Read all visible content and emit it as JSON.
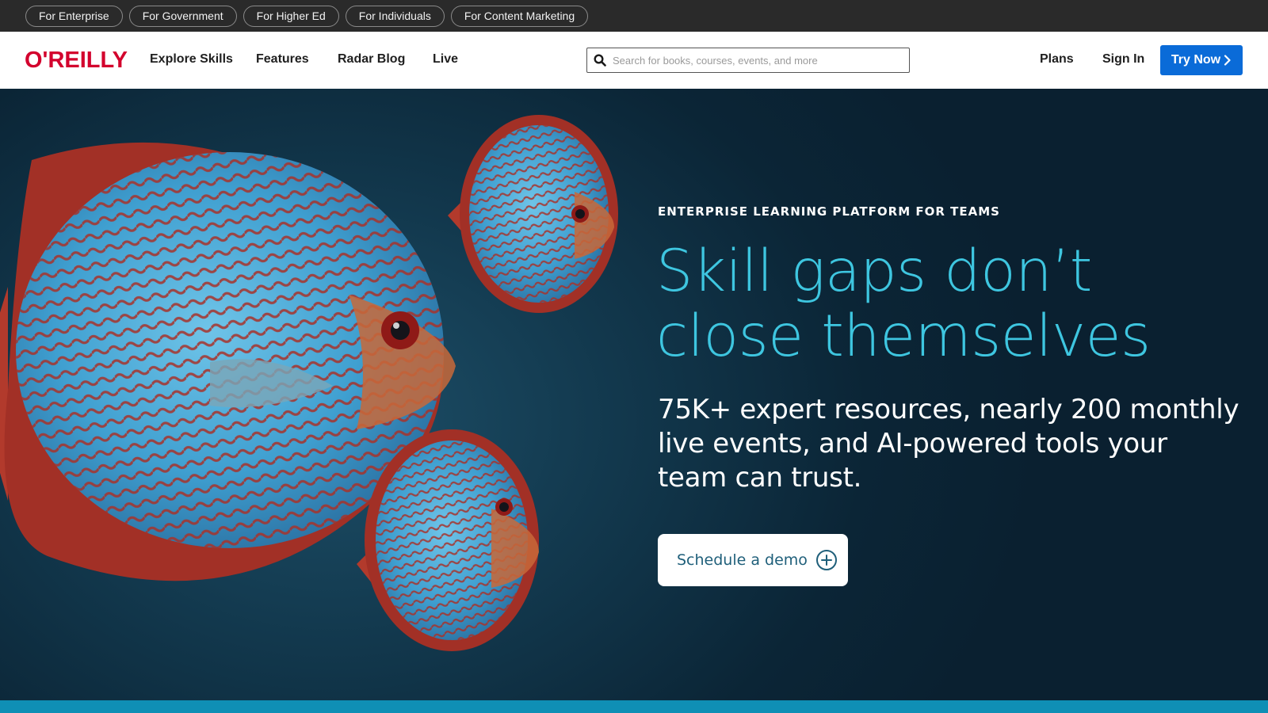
{
  "audience_bar": {
    "items": [
      "For Enterprise",
      "For Government",
      "For Higher Ed",
      "For Individuals",
      "For Content Marketing"
    ]
  },
  "nav": {
    "logo": "O'REILLY",
    "links": [
      "Explore Skills",
      "Features",
      "Radar Blog",
      "Live"
    ],
    "search_placeholder": "Search for books, courses, events, and more",
    "plans": "Plans",
    "sign_in": "Sign In",
    "try_now": "Try Now"
  },
  "hero": {
    "eyebrow": "ENTERPRISE LEARNING PLATFORM FOR TEAMS",
    "headline_line1": "Skill gaps don’t",
    "headline_line2": "close themselves",
    "subhead": "75K+ expert resources, nearly 200 monthly live events, and AI-powered tools your team can trust.",
    "cta_label": "Schedule a demo"
  },
  "colors": {
    "brand_red": "#d3002d",
    "accent_blue": "#0a6bd8",
    "headline_cyan": "#3ec6e0",
    "hero_bg": "#0d2433"
  },
  "icons": {
    "search": "search-icon",
    "chevron": "chevron-right-icon",
    "plus_circle": "plus-circle-icon"
  }
}
